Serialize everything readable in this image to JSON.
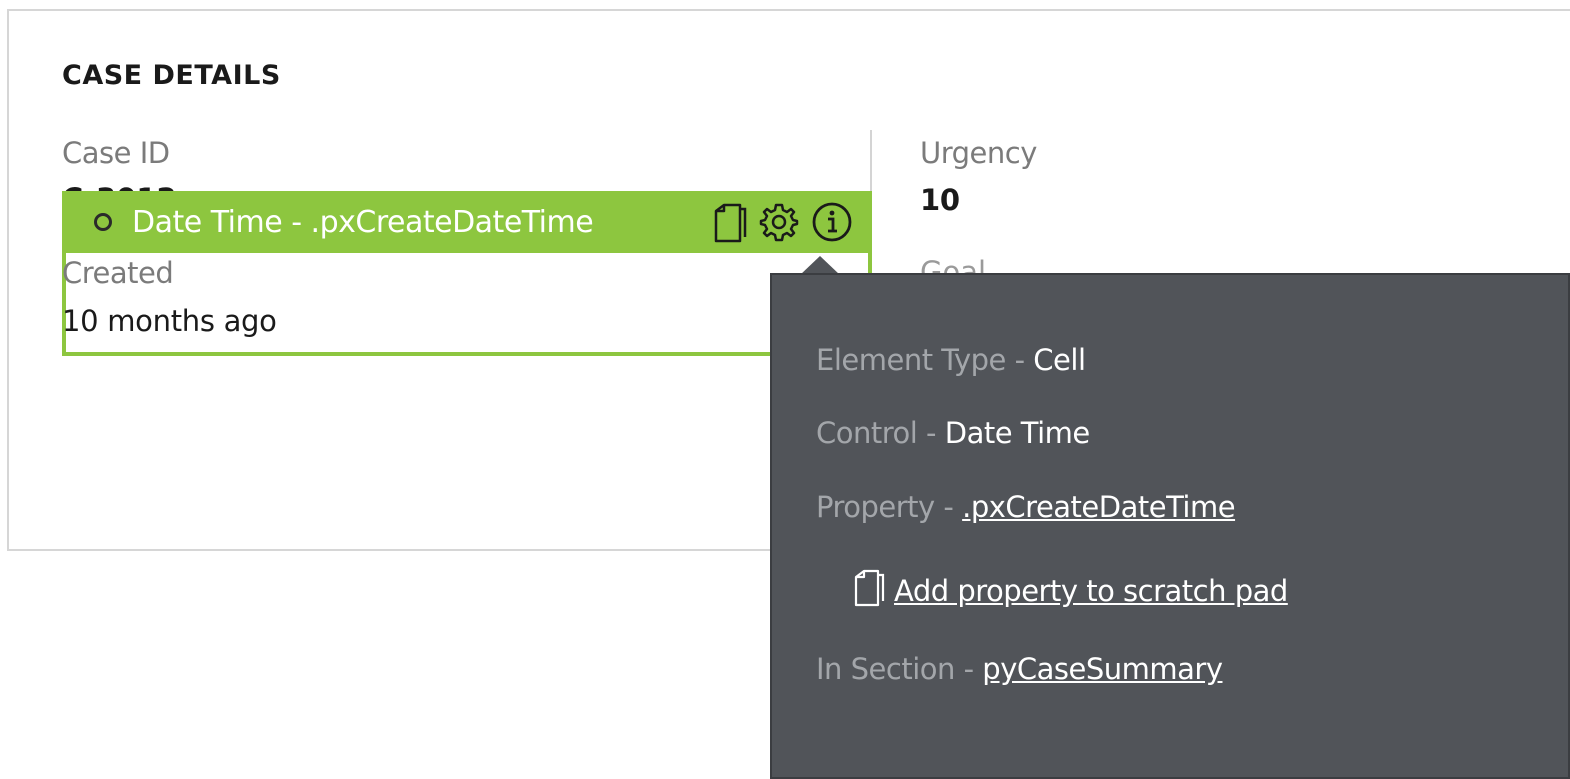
{
  "section": {
    "title": "CASE DETAILS"
  },
  "fields": {
    "case_id_label": "Case ID",
    "case_id_value_partial": "C-3012",
    "created_label": "Created",
    "created_value": "10 months ago",
    "urgency_label": "Urgency",
    "urgency_value": "10",
    "goal_label_partial": "Goal"
  },
  "highlight": {
    "label": "Date Time - .pxCreateDateTime",
    "icons": [
      "copy-icon",
      "gear-icon",
      "info-icon"
    ],
    "color": "#8dc63f"
  },
  "tooltip": {
    "element_type_key": "Element Type -",
    "element_type_value": "Cell",
    "control_key": "Control -",
    "control_value": "Date Time",
    "property_key": "Property -",
    "property_value": ".pxCreateDateTime",
    "scratch_pad_link": "Add property to scratch pad",
    "section_key": "In Section -",
    "section_value": "pyCaseSummary",
    "background": "#515459"
  }
}
